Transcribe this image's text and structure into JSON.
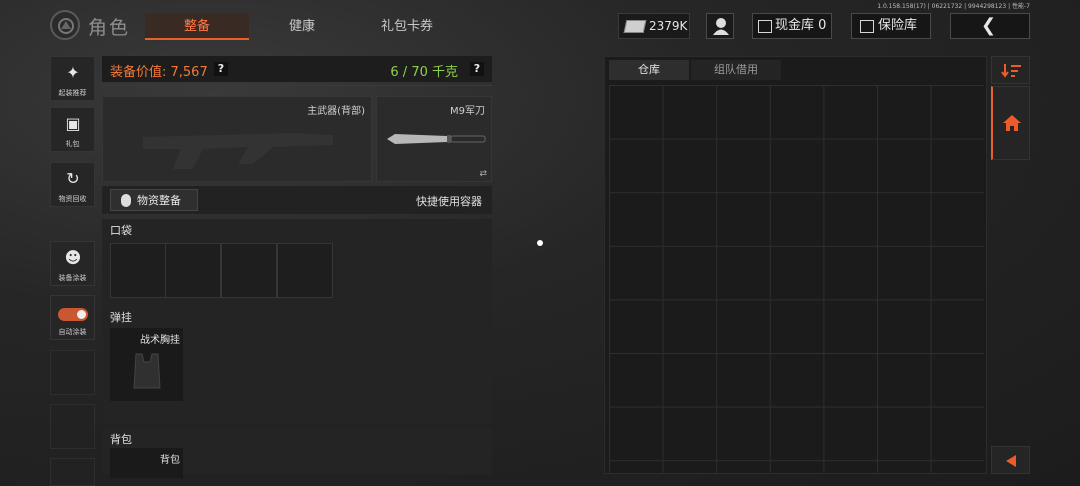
{
  "version_text": "1.0.158.158(17) | 06221732 | 9944298123 | 性能-7",
  "header": {
    "title": "角色",
    "tabs": [
      {
        "label": "整备",
        "active": true
      },
      {
        "label": "健康",
        "active": false
      },
      {
        "label": "礼包卡券",
        "active": false
      }
    ],
    "money": "2379K",
    "cash_label": "现金库 0",
    "safe_label": "保险库"
  },
  "sidebar": {
    "items": [
      {
        "label": "起装推荐"
      },
      {
        "label": "礼包"
      },
      {
        "label": "物资回收"
      },
      {
        "label": "装备涂装"
      },
      {
        "label": "自动涂装"
      }
    ]
  },
  "equipment": {
    "value_label": "装备价值: 7,567",
    "help": "?",
    "weight_label": "6 / 70 千克",
    "primary_weapon_label": "主武器(背部)",
    "melee_label": "M9军刀",
    "swap_glyph": "⇄",
    "supply_button": "物资整备",
    "quick_container": "快捷使用容器",
    "pocket_header": "口袋",
    "rig_header": "弹挂",
    "rig_item": "战术胸挂",
    "backpack_header": "背包",
    "backpack_item": "背包"
  },
  "storage": {
    "tabs": [
      {
        "label": "仓库",
        "active": true
      },
      {
        "label": "组队借用",
        "active": false
      }
    ]
  },
  "colors": {
    "accent": "#e8602c",
    "weight_green": "#8fcf4e"
  }
}
